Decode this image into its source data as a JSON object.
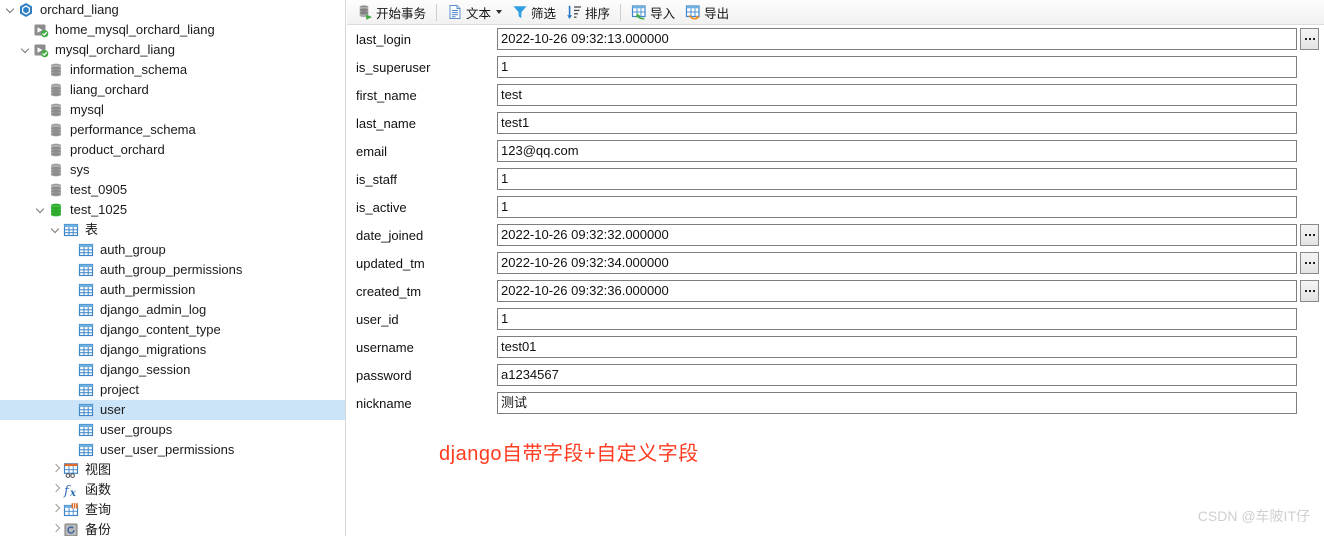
{
  "sidebar": {
    "tree": [
      {
        "label": "orchard_liang",
        "indent": 0,
        "twisty": "expanded",
        "icon": "navicat-connection-icon"
      },
      {
        "label": "home_mysql_orchard_liang",
        "indent": 1,
        "twisty": "none",
        "icon": "mysql-connection-icon"
      },
      {
        "label": "mysql_orchard_liang",
        "indent": 1,
        "twisty": "expanded",
        "icon": "mysql-connection-icon"
      },
      {
        "label": "information_schema",
        "indent": 2,
        "twisty": "none",
        "icon": "database-icon"
      },
      {
        "label": "liang_orchard",
        "indent": 2,
        "twisty": "none",
        "icon": "database-icon"
      },
      {
        "label": "mysql",
        "indent": 2,
        "twisty": "none",
        "icon": "database-icon"
      },
      {
        "label": "performance_schema",
        "indent": 2,
        "twisty": "none",
        "icon": "database-icon"
      },
      {
        "label": "product_orchard",
        "indent": 2,
        "twisty": "none",
        "icon": "database-icon"
      },
      {
        "label": "sys",
        "indent": 2,
        "twisty": "none",
        "icon": "database-icon"
      },
      {
        "label": "test_0905",
        "indent": 2,
        "twisty": "none",
        "icon": "database-icon"
      },
      {
        "label": "test_1025",
        "indent": 2,
        "twisty": "expanded",
        "icon": "database-open-icon"
      },
      {
        "label": "表",
        "indent": 3,
        "twisty": "expanded",
        "icon": "tables-folder-icon"
      },
      {
        "label": "auth_group",
        "indent": 4,
        "twisty": "none",
        "icon": "table-icon"
      },
      {
        "label": "auth_group_permissions",
        "indent": 4,
        "twisty": "none",
        "icon": "table-icon"
      },
      {
        "label": "auth_permission",
        "indent": 4,
        "twisty": "none",
        "icon": "table-icon"
      },
      {
        "label": "django_admin_log",
        "indent": 4,
        "twisty": "none",
        "icon": "table-icon"
      },
      {
        "label": "django_content_type",
        "indent": 4,
        "twisty": "none",
        "icon": "table-icon"
      },
      {
        "label": "django_migrations",
        "indent": 4,
        "twisty": "none",
        "icon": "table-icon"
      },
      {
        "label": "django_session",
        "indent": 4,
        "twisty": "none",
        "icon": "table-icon"
      },
      {
        "label": "project",
        "indent": 4,
        "twisty": "none",
        "icon": "table-icon"
      },
      {
        "label": "user",
        "indent": 4,
        "twisty": "none",
        "icon": "table-icon",
        "selected": true
      },
      {
        "label": "user_groups",
        "indent": 4,
        "twisty": "none",
        "icon": "table-icon"
      },
      {
        "label": "user_user_permissions",
        "indent": 4,
        "twisty": "none",
        "icon": "table-icon"
      },
      {
        "label": "视图",
        "indent": 3,
        "twisty": "collapsed",
        "icon": "views-icon"
      },
      {
        "label": "函数",
        "indent": 3,
        "twisty": "collapsed",
        "icon": "functions-icon"
      },
      {
        "label": "查询",
        "indent": 3,
        "twisty": "collapsed",
        "icon": "queries-icon"
      },
      {
        "label": "备份",
        "indent": 3,
        "twisty": "collapsed",
        "icon": "backups-icon"
      }
    ]
  },
  "toolbar": {
    "items": [
      {
        "label": "开始事务",
        "icon": "begin-transaction-icon",
        "caret": false
      },
      {
        "sep": true
      },
      {
        "label": "文本",
        "icon": "text-icon",
        "caret": true
      },
      {
        "label": "筛选",
        "icon": "filter-icon",
        "caret": false
      },
      {
        "label": "排序",
        "icon": "sort-icon",
        "caret": false
      },
      {
        "sep": true
      },
      {
        "label": "导入",
        "icon": "import-icon",
        "caret": false
      },
      {
        "label": "导出",
        "icon": "export-icon",
        "caret": false
      }
    ]
  },
  "form": {
    "fields": [
      {
        "label": "last_login",
        "value": "2022-10-26 09:32:13.000000",
        "has_picker": true
      },
      {
        "label": "is_superuser",
        "value": "1",
        "has_picker": false
      },
      {
        "label": "first_name",
        "value": "test",
        "has_picker": false
      },
      {
        "label": "last_name",
        "value": "test1",
        "has_picker": false
      },
      {
        "label": "email",
        "value": "123@qq.com",
        "has_picker": false
      },
      {
        "label": "is_staff",
        "value": "1",
        "has_picker": false
      },
      {
        "label": "is_active",
        "value": "1",
        "has_picker": false
      },
      {
        "label": "date_joined",
        "value": "2022-10-26 09:32:32.000000",
        "has_picker": true
      },
      {
        "label": "updated_tm",
        "value": "2022-10-26 09:32:34.000000",
        "has_picker": true
      },
      {
        "label": "created_tm",
        "value": "2022-10-26 09:32:36.000000",
        "has_picker": true
      },
      {
        "label": "user_id",
        "value": "1",
        "has_picker": false
      },
      {
        "label": "username",
        "value": "test01",
        "has_picker": false
      },
      {
        "label": "password",
        "value": "a1234567",
        "has_picker": false
      },
      {
        "label": "nickname",
        "value": "测试",
        "has_picker": false
      }
    ]
  },
  "annotation": {
    "text": "django自带字段+自定义字段",
    "color": "#ff3b20"
  },
  "watermark": {
    "text": "CSDN @车陂IT仔"
  }
}
